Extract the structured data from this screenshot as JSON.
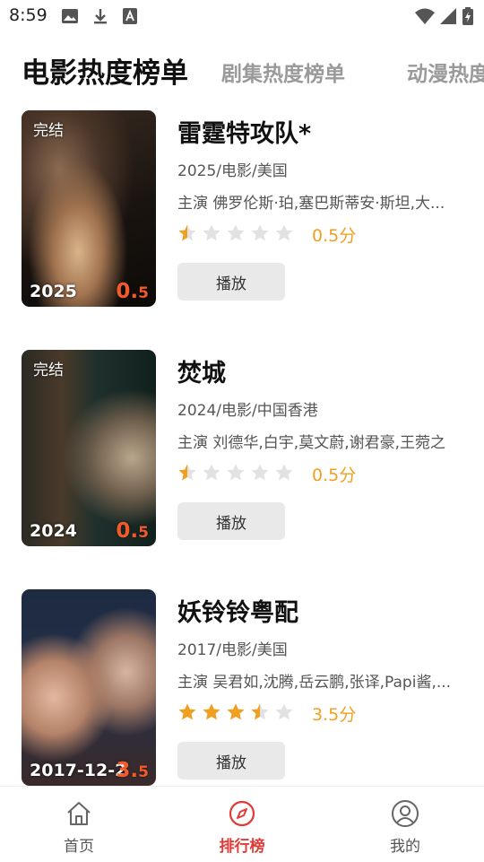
{
  "status_bar": {
    "time": "8:59"
  },
  "tabs": [
    {
      "label": "电影热度榜单",
      "active": true
    },
    {
      "label": "剧集热度榜单",
      "active": false
    },
    {
      "label": "动漫热度",
      "active": false
    }
  ],
  "movies": [
    {
      "title": "雷霆特攻队*",
      "meta": "2025/电影/美国",
      "cast": "主演 佛罗伦斯·珀,塞巴斯蒂安·斯坦,大...",
      "rating_text": "0.5分",
      "rating_value": 0.5,
      "poster_status": "完结",
      "poster_year": "2025",
      "poster_score_main": "0.",
      "poster_score_small": "5",
      "play_label": "播放"
    },
    {
      "title": "焚城",
      "meta": "2024/电影/中国香港",
      "cast": "主演 刘德华,白宇,莫文蔚,谢君豪,王菀之",
      "rating_text": "0.5分",
      "rating_value": 0.5,
      "poster_status": "完结",
      "poster_year": "2024",
      "poster_score_main": "0.",
      "poster_score_small": "5",
      "play_label": "播放"
    },
    {
      "title": "妖铃铃粤配",
      "meta": "2017/电影/美国",
      "cast": "主演 吴君如,沈腾,岳云鹏,张译,Papi酱,...",
      "rating_text": "3.5分",
      "rating_value": 3.5,
      "poster_status": "",
      "poster_year": "2017-12-2",
      "poster_score_main": "3.",
      "poster_score_small": "5",
      "play_label": "播放"
    }
  ],
  "bottom_nav": [
    {
      "label": "首页",
      "icon": "home-icon",
      "active": false
    },
    {
      "label": "排行榜",
      "icon": "compass-icon",
      "active": true
    },
    {
      "label": "我的",
      "icon": "profile-icon",
      "active": false
    }
  ],
  "colors": {
    "accent": "#e23a35",
    "star_filled": "#f0a020",
    "star_empty": "#e2e2e2",
    "poster_score": "#f25a2a"
  }
}
